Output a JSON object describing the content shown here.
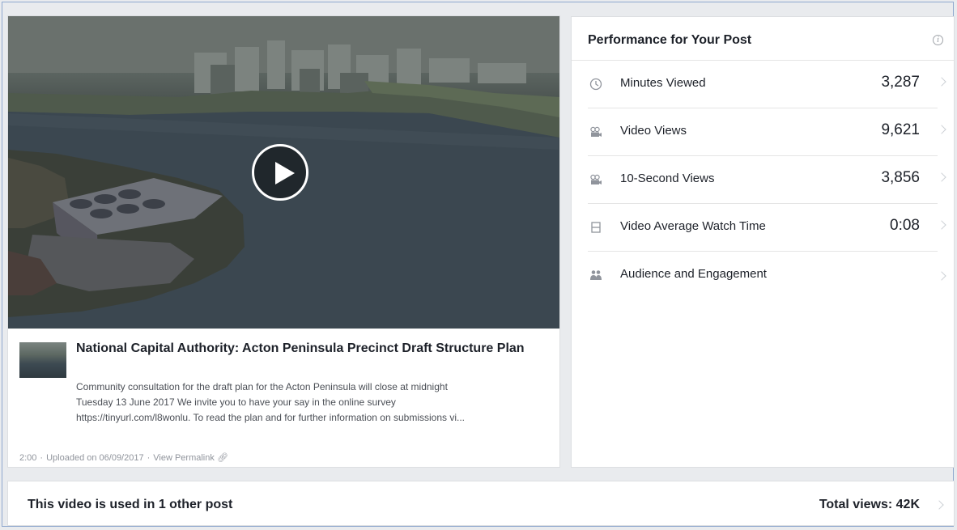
{
  "post": {
    "title": "National Capital Authority: Acton Peninsula Precinct Draft Structure Plan",
    "description_lines": [
      "Community consultation for the draft plan for the Acton Peninsula will close at midnight",
      "Tuesday 13 June 2017 We invite you to have your say in the online survey",
      "https://tinyurl.com/l8wonlu. To read the plan and for further information on submissions vi..."
    ],
    "duration": "2:00",
    "uploaded": "Uploaded on 06/09/2017",
    "permalink_label": "View Permalink"
  },
  "performance": {
    "title": "Performance for Your Post",
    "info_icon": "i",
    "metrics": [
      {
        "icon": "clock-icon",
        "label": "Minutes Viewed",
        "value": "3,287"
      },
      {
        "icon": "video-camera-icon",
        "label": "Video Views",
        "value": "9,621"
      },
      {
        "icon": "video-camera-icon",
        "label": "10-Second Views",
        "value": "3,856"
      },
      {
        "icon": "film-strip-icon",
        "label": "Video Average Watch Time",
        "value": "0:08"
      },
      {
        "icon": "people-icon",
        "label": "Audience and Engagement",
        "value": ""
      }
    ]
  },
  "usage": {
    "label": "This video is used in 1 other post",
    "total": "Total views: 42K"
  }
}
